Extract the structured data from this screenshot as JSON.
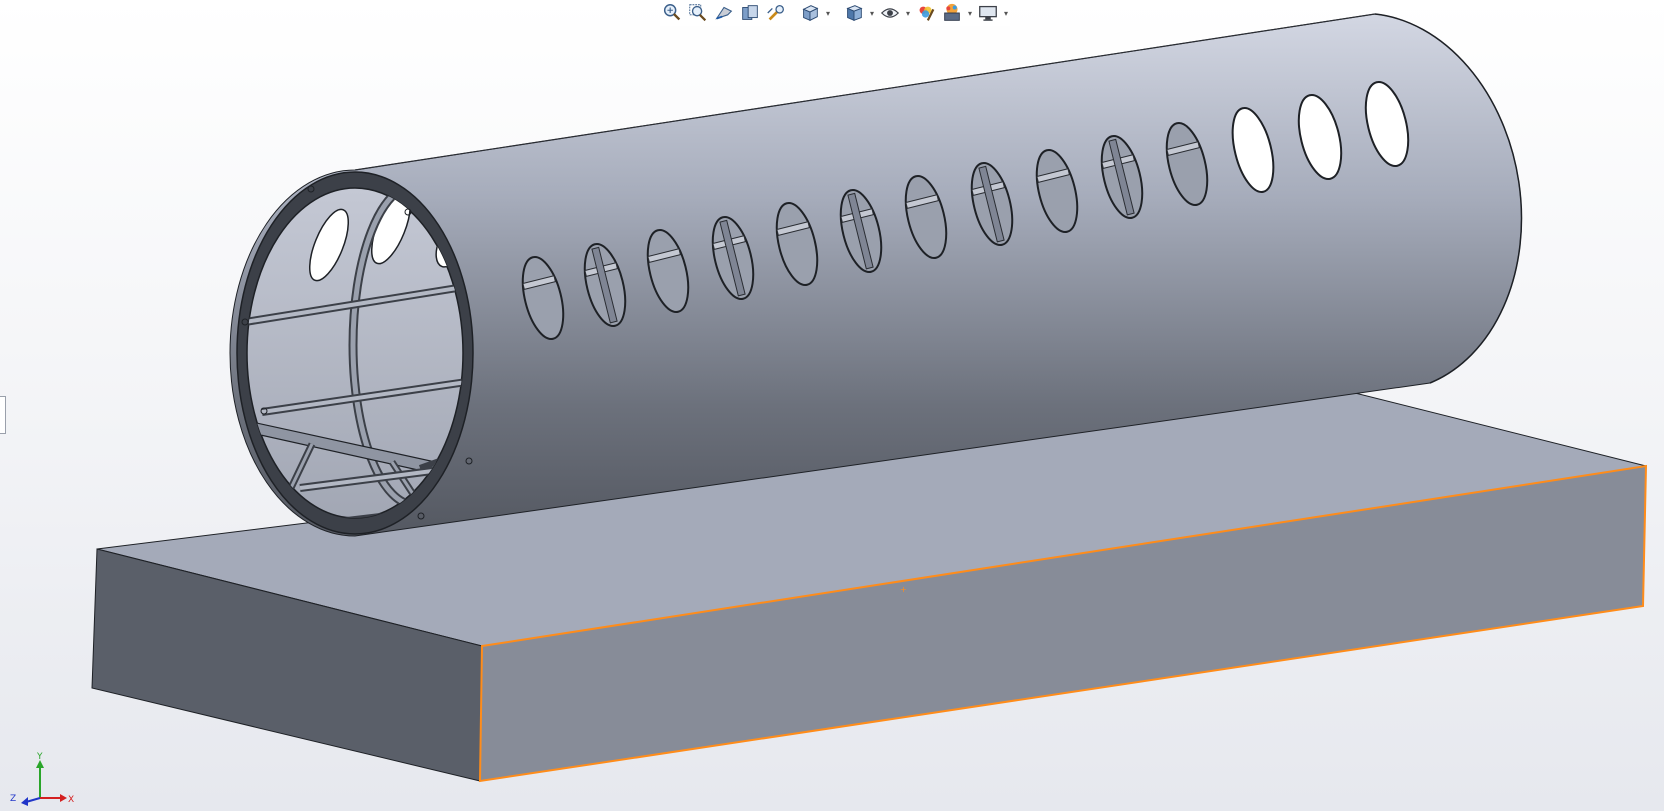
{
  "toolbar": {
    "buttons": [
      {
        "name": "zoom-to-fit",
        "icon": "zoom-to-fit-icon",
        "dropdown": false
      },
      {
        "name": "zoom-to-area",
        "icon": "zoom-to-area-icon",
        "dropdown": false
      },
      {
        "name": "previous-view",
        "icon": "previous-view-icon",
        "dropdown": false
      },
      {
        "name": "section-view",
        "icon": "section-view-icon",
        "dropdown": false
      },
      {
        "name": "dynamic-annotation-views",
        "icon": "dynamic-annotation-icon",
        "dropdown": false
      },
      {
        "name": "view-orientation",
        "icon": "view-orientation-cube-icon",
        "dropdown": true
      },
      {
        "name": "display-style",
        "icon": "display-style-icon",
        "dropdown": true
      },
      {
        "name": "hide-show-items",
        "icon": "hide-show-eye-icon",
        "dropdown": true
      },
      {
        "name": "edit-appearance",
        "icon": "edit-appearance-icon",
        "dropdown": false
      },
      {
        "name": "apply-scene",
        "icon": "apply-scene-icon",
        "dropdown": true
      },
      {
        "name": "view-settings",
        "icon": "view-settings-monitor-icon",
        "dropdown": true
      }
    ]
  },
  "triad": {
    "x_label": "X",
    "y_label": "Y",
    "z_label": "Z"
  },
  "colors": {
    "model_face_light": "#a4aab9",
    "model_face_dark": "#5a5f69",
    "selection_edge": "#ff8c1a",
    "edge_line": "#1e2126"
  }
}
